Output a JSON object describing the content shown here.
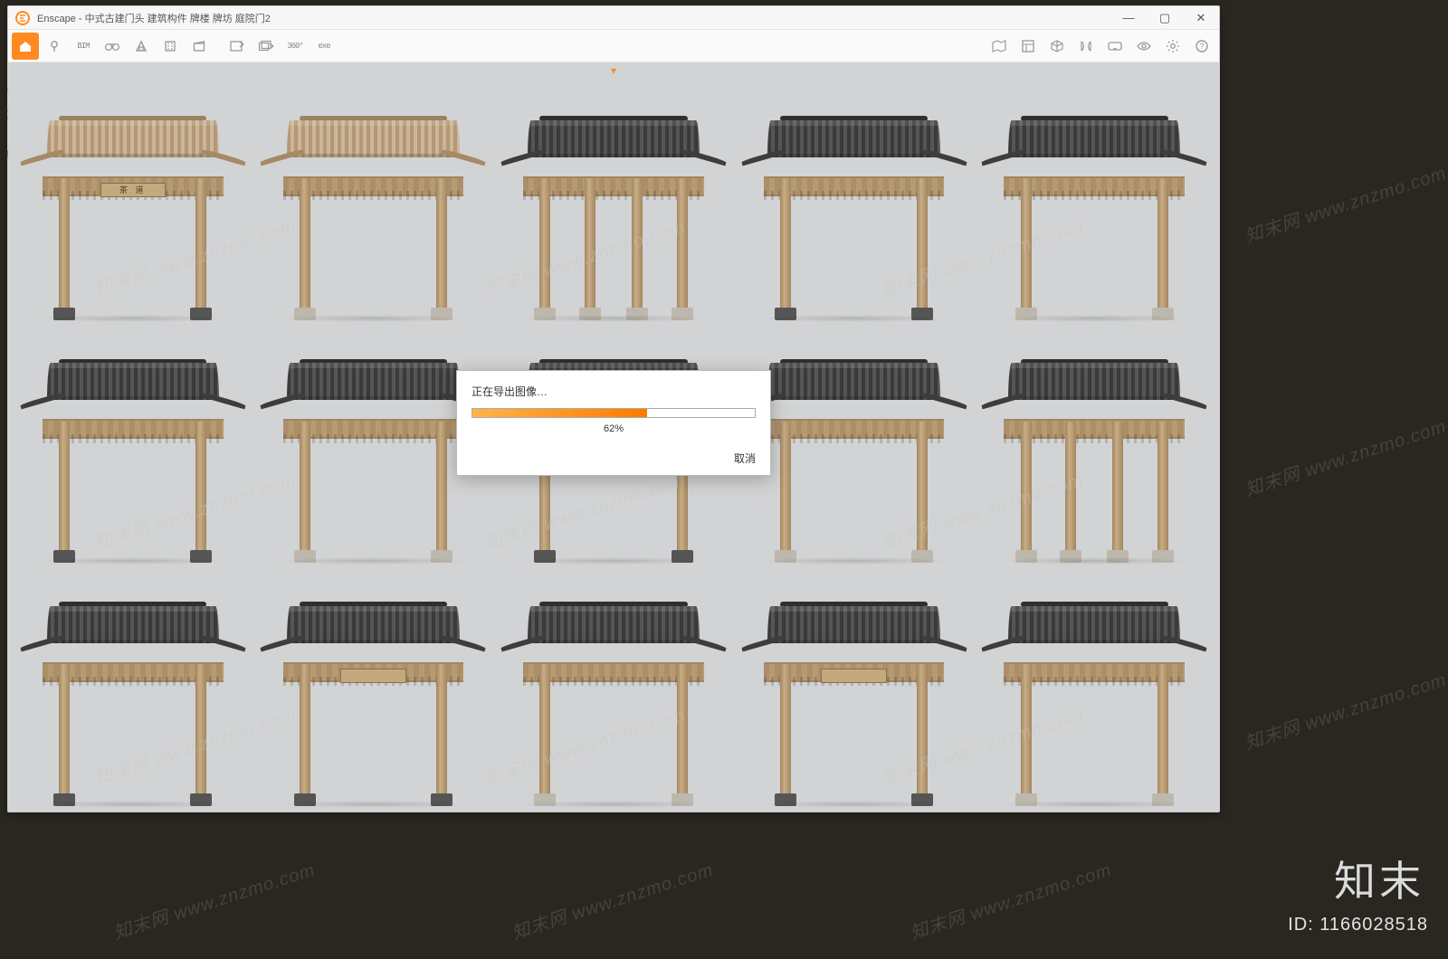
{
  "window": {
    "app_name": "Enscape",
    "title": "Enscape - 中式古建门头 建筑构件 牌楼 牌坊 庭院门2",
    "controls": {
      "minimize": "—",
      "maximize": "▢",
      "close": "✕"
    }
  },
  "toolbar": {
    "left": [
      {
        "name": "home-icon"
      },
      {
        "name": "pin-icon"
      },
      {
        "name": "bim-icon",
        "label": "BIM"
      },
      {
        "name": "binoculars-icon"
      },
      {
        "name": "triangle-icon"
      },
      {
        "name": "building-icon"
      },
      {
        "name": "clapboard-icon"
      },
      {
        "name": "export-image-icon"
      },
      {
        "name": "export-batch-icon"
      },
      {
        "name": "view-360-icon",
        "label": "360°"
      },
      {
        "name": "export-exe-icon",
        "label": "exe"
      }
    ],
    "right": [
      {
        "name": "map-icon"
      },
      {
        "name": "asset-library-icon"
      },
      {
        "name": "cube-icon"
      },
      {
        "name": "compare-icon"
      },
      {
        "name": "vr-icon"
      },
      {
        "name": "visibility-icon"
      },
      {
        "name": "settings-icon"
      },
      {
        "name": "help-icon"
      }
    ]
  },
  "sidecrop": {
    "a": "书",
    "b": "文",
    "c": "缩"
  },
  "modal": {
    "title": "正在导出图像…",
    "progress_percent": 62,
    "progress_label": "62%",
    "cancel_label": "取消"
  },
  "gates": [
    {
      "roof": "light",
      "pillars": 2,
      "base": "dark",
      "plaque": "茶 道"
    },
    {
      "roof": "light",
      "pillars": 2,
      "base": "stone"
    },
    {
      "roof": "dark",
      "pillars": 4,
      "base": "stone"
    },
    {
      "roof": "dark",
      "pillars": 2,
      "base": "dark"
    },
    {
      "roof": "dark",
      "pillars": 2,
      "base": "stone"
    },
    {
      "roof": "dark",
      "pillars": 2,
      "base": "dark"
    },
    {
      "roof": "dark",
      "pillars": 2,
      "base": "stone"
    },
    {
      "roof": "dark",
      "pillars": 2,
      "base": "dark"
    },
    {
      "roof": "dark",
      "pillars": 2,
      "base": "stone"
    },
    {
      "roof": "dark",
      "pillars": 4,
      "base": "stone"
    },
    {
      "roof": "dark",
      "pillars": 2,
      "base": "dark"
    },
    {
      "roof": "dark",
      "pillars": 2,
      "base": "dark",
      "plaque": ""
    },
    {
      "roof": "dark",
      "pillars": 2,
      "base": "stone"
    },
    {
      "roof": "dark",
      "pillars": 2,
      "base": "dark",
      "plaque": ""
    },
    {
      "roof": "dark",
      "pillars": 2,
      "base": "stone"
    }
  ],
  "watermark": {
    "text": "知末网 www.znzmo.com",
    "brand_text": "知末",
    "id_label": "ID: 1166028518"
  },
  "colors": {
    "accent": "#ff7a00"
  }
}
